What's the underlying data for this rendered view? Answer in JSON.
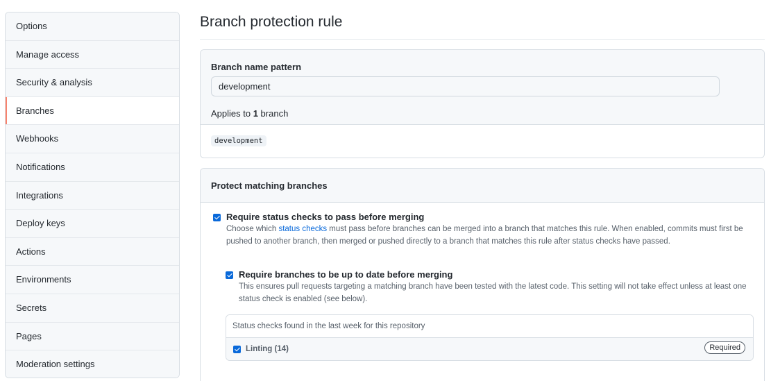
{
  "sidebar": {
    "items": [
      {
        "label": "Options"
      },
      {
        "label": "Manage access"
      },
      {
        "label": "Security & analysis"
      },
      {
        "label": "Branches",
        "selected": true
      },
      {
        "label": "Webhooks"
      },
      {
        "label": "Notifications"
      },
      {
        "label": "Integrations"
      },
      {
        "label": "Deploy keys"
      },
      {
        "label": "Actions"
      },
      {
        "label": "Environments"
      },
      {
        "label": "Secrets"
      },
      {
        "label": "Pages"
      },
      {
        "label": "Moderation settings"
      }
    ]
  },
  "main": {
    "title": "Branch protection rule",
    "pattern": {
      "label": "Branch name pattern",
      "value": "development",
      "applies_prefix": "Applies to ",
      "applies_count": "1",
      "applies_suffix": " branch",
      "matched_branch": "development"
    },
    "protect": {
      "heading": "Protect matching branches",
      "status_checks": {
        "checked": true,
        "title": "Require status checks to pass before merging",
        "desc_before": "Choose which ",
        "desc_link": "status checks",
        "desc_after": " must pass before branches can be merged into a branch that matches this rule. When enabled, commits must first be pushed to another branch, then merged or pushed directly to a branch that matches this rule after status checks have passed."
      },
      "up_to_date": {
        "checked": true,
        "title": "Require branches to be up to date before merging",
        "desc": "This ensures pull requests targeting a matching branch have been tested with the latest code. This setting will not take effect unless at least one status check is enabled (see below)."
      },
      "checks_found": {
        "header": "Status checks found in the last week for this repository",
        "items": [
          {
            "name": "Linting (14)",
            "checked": true,
            "badge": "Required"
          }
        ]
      }
    }
  },
  "colors": {
    "accent": "#0969da",
    "selected_marker": "#f9826c",
    "border": "#d8dee4",
    "subtle_bg": "#f6f8fa"
  }
}
